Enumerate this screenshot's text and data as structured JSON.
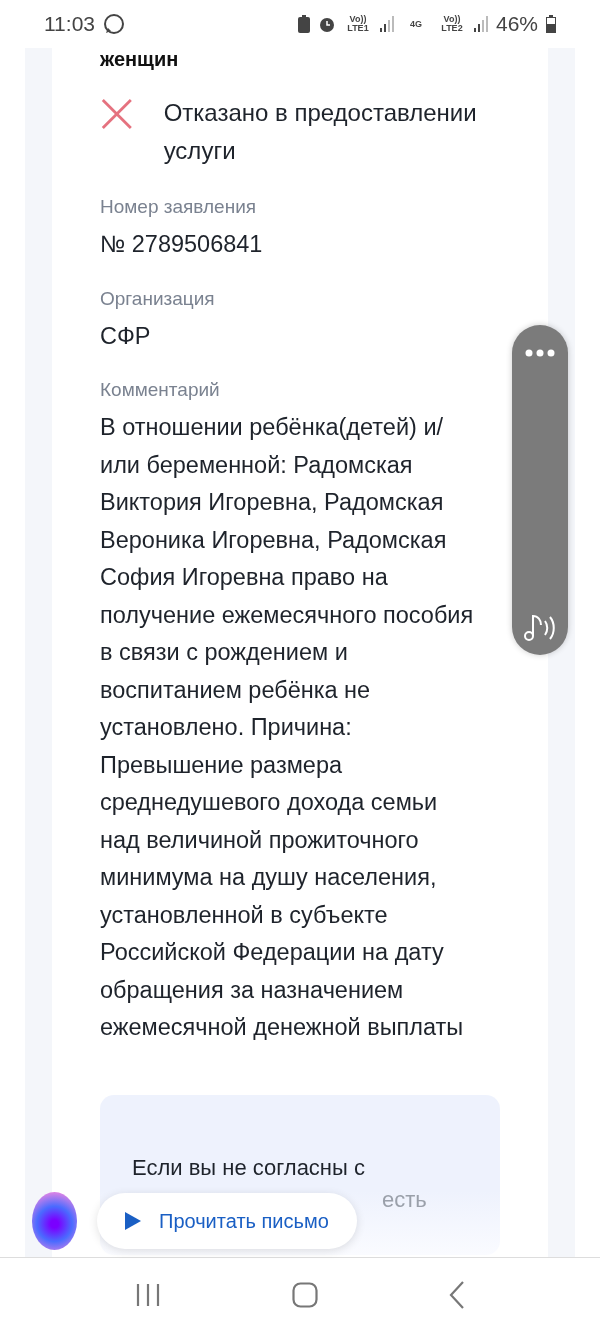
{
  "status_bar": {
    "time": "11:03",
    "indicators": [
      "Vo)) LTE1",
      "4G",
      "Vo)) LTE2"
    ],
    "battery": "46%"
  },
  "card": {
    "title_fragment": "женщин",
    "status": {
      "kind": "rejected",
      "text": "Отказано в предоставлении услуги"
    },
    "fields": [
      {
        "label": "Номер заявления",
        "value": "№ 2789506841"
      },
      {
        "label": "Организация",
        "value": "СФР"
      },
      {
        "label": "Комментарий",
        "value": "В отношении ребёнка(детей) и/или беременной: Радомская Виктория Игоревна, Радомская Вероника Игоревна, Радомская София Игоревна право на получение ежемесячного пособия в связи с рождением и воспитанием ребёнка не установлено. Причина: Превышение размера среднедушевого дохода семьи над величиной прожиточного минимума на душу населения, установленной в субъекте Российской Федерации на дату обращения за назначением ежемесячной денежной выплаты"
      }
    ],
    "notice": {
      "text": "Если вы не согласны с",
      "fragment": "есть"
    }
  },
  "read_bubble": {
    "label": "Прочитать письмо"
  }
}
